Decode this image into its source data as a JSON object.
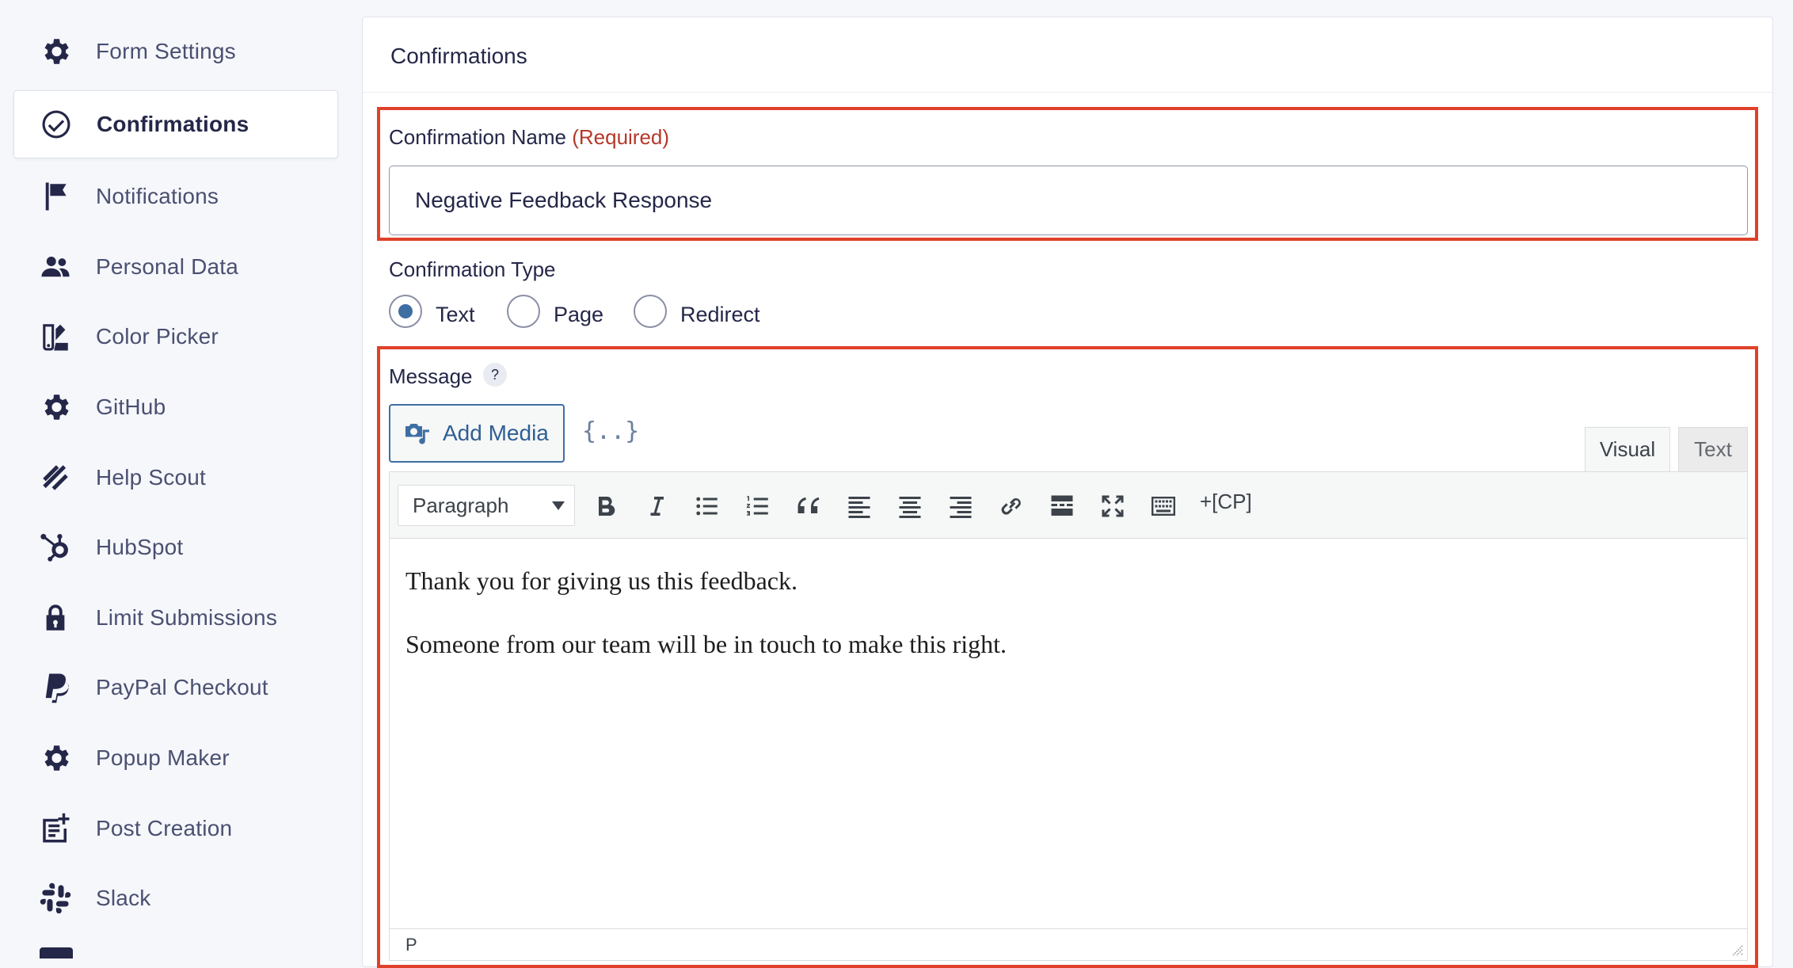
{
  "sidebar": {
    "items": [
      {
        "label": "Form Settings",
        "icon": "gear-icon"
      },
      {
        "label": "Confirmations",
        "icon": "check-circle-icon",
        "active": true
      },
      {
        "label": "Notifications",
        "icon": "flag-icon"
      },
      {
        "label": "Personal Data",
        "icon": "users-icon"
      },
      {
        "label": "Color Picker",
        "icon": "color-swatch-icon"
      },
      {
        "label": "GitHub",
        "icon": "gear-icon"
      },
      {
        "label": "Help Scout",
        "icon": "helpscout-icon"
      },
      {
        "label": "HubSpot",
        "icon": "hubspot-icon"
      },
      {
        "label": "Limit Submissions",
        "icon": "lock-icon"
      },
      {
        "label": "PayPal Checkout",
        "icon": "paypal-icon"
      },
      {
        "label": "Popup Maker",
        "icon": "gear-icon"
      },
      {
        "label": "Post Creation",
        "icon": "post-add-icon"
      },
      {
        "label": "Slack",
        "icon": "slack-icon"
      }
    ]
  },
  "panel": {
    "title": "Confirmations"
  },
  "form": {
    "name_label": "Confirmation Name",
    "name_required": "(Required)",
    "name_value": "Negative Feedback Response",
    "type_label": "Confirmation Type",
    "type_options": [
      "Text",
      "Page",
      "Redirect"
    ],
    "type_selected": "Text",
    "message_label": "Message",
    "help_glyph": "?"
  },
  "editor": {
    "add_media_label": "Add Media",
    "merge_tags_glyph": "{..}",
    "tabs": [
      "Visual",
      "Text"
    ],
    "active_tab": "Visual",
    "format_select": "Paragraph",
    "cp_label": "+[CP]",
    "content": [
      "Thank you for giving us this feedback.",
      "Someone from our team will be in touch to make this right."
    ],
    "status_path": "P"
  },
  "colors": {
    "highlight": "#e0412b",
    "accent": "#3e6fa3",
    "required": "#b5392a"
  }
}
